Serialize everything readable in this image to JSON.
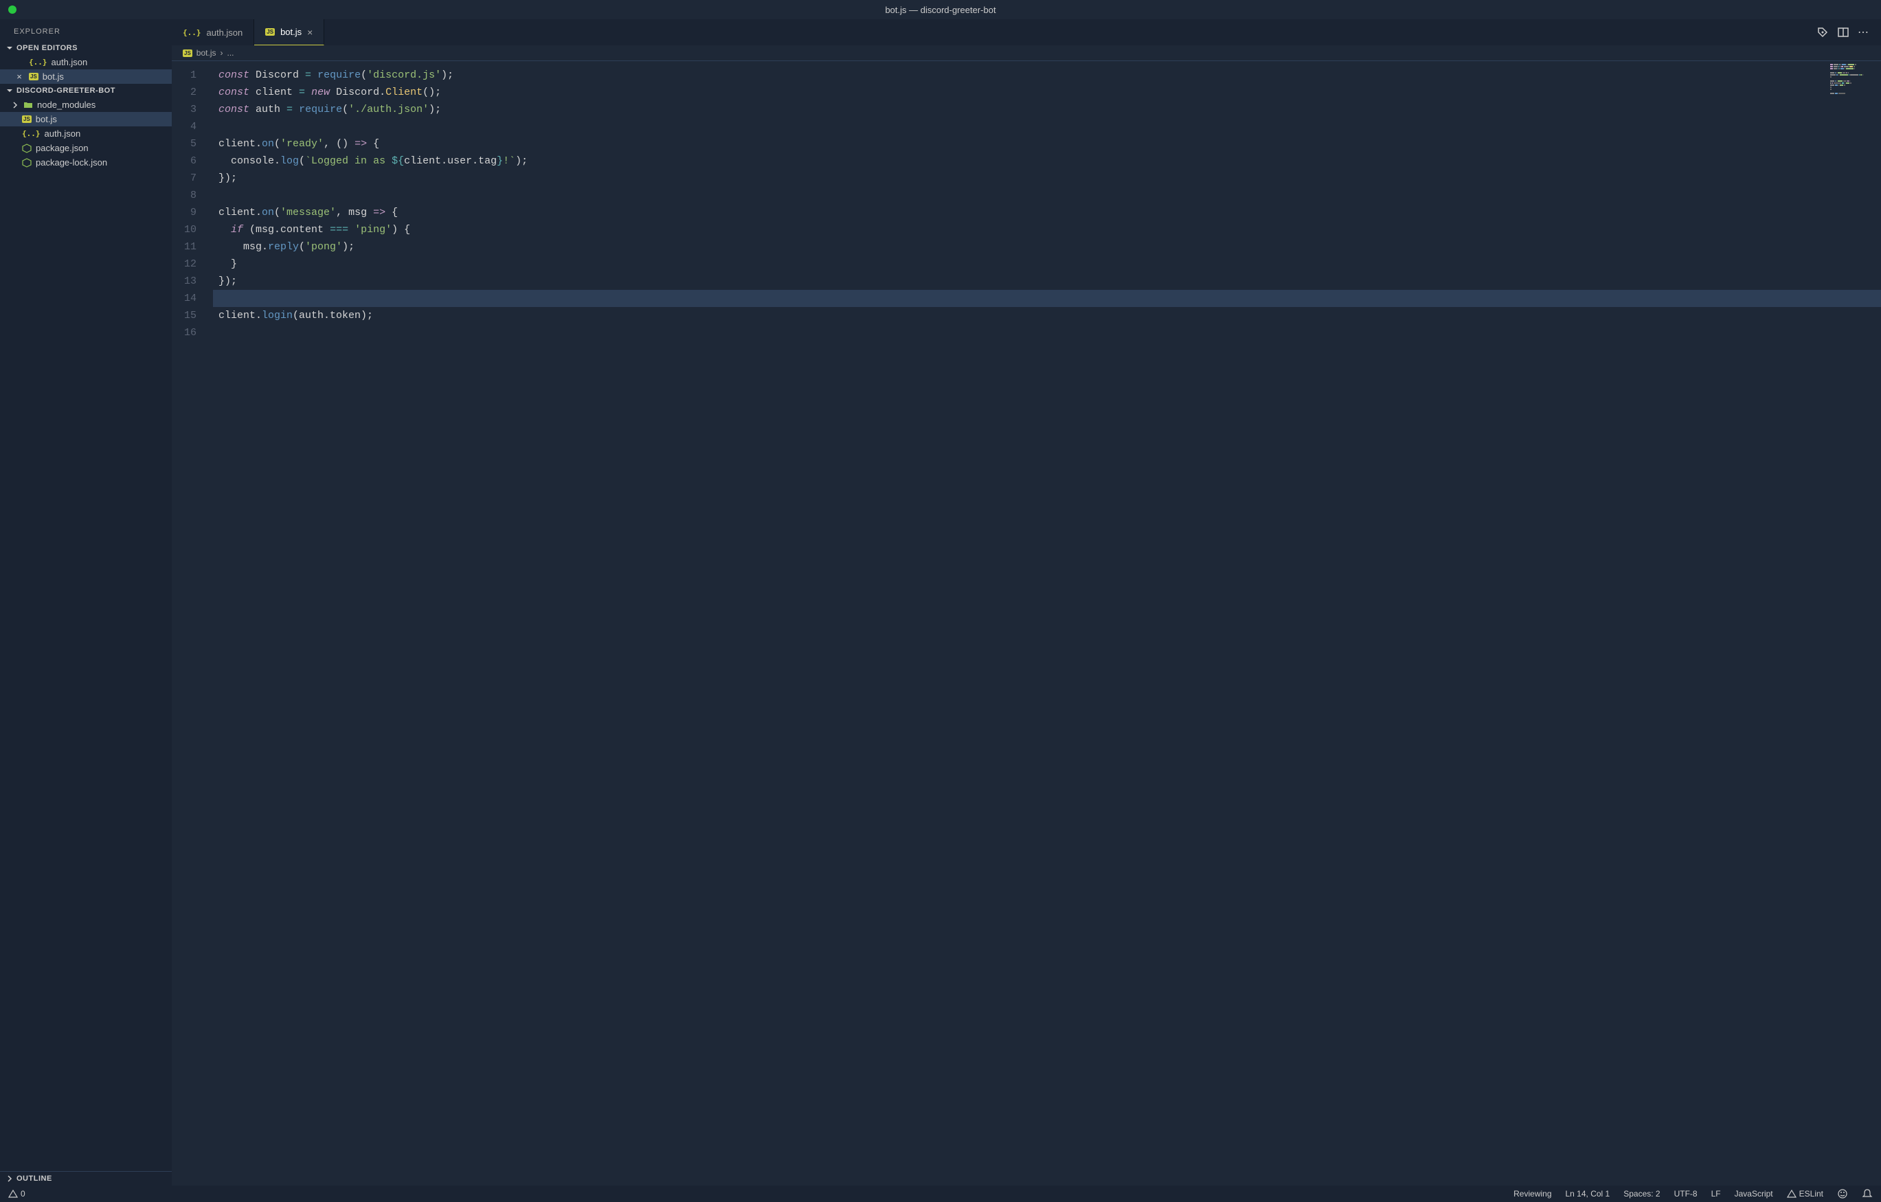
{
  "titlebar": {
    "title": "bot.js — discord-greeter-bot"
  },
  "sidebar": {
    "explorer_label": "EXPLORER",
    "open_editors_label": "OPEN EDITORS",
    "open_editors": [
      {
        "name": "auth.json",
        "icon": "json",
        "modified": false
      },
      {
        "name": "bot.js",
        "icon": "js",
        "modified": true,
        "active": true
      }
    ],
    "project_label": "DISCORD-GREETER-BOT",
    "files": [
      {
        "name": "node_modules",
        "icon": "folder",
        "chevron": true
      },
      {
        "name": "bot.js",
        "icon": "js",
        "active": true
      },
      {
        "name": "auth.json",
        "icon": "json"
      },
      {
        "name": "package.json",
        "icon": "npm"
      },
      {
        "name": "package-lock.json",
        "icon": "npm"
      }
    ],
    "outline_label": "OUTLINE"
  },
  "tabs": [
    {
      "name": "auth.json",
      "icon": "json",
      "active": false
    },
    {
      "name": "bot.js",
      "icon": "js",
      "active": true
    }
  ],
  "breadcrumb": {
    "file": "bot.js",
    "more": "..."
  },
  "code": {
    "line_count": 16,
    "highlighted_line": 14,
    "lines": [
      [
        [
          "keyword",
          "const"
        ],
        [
          "var",
          " Discord "
        ],
        [
          "op",
          "="
        ],
        [
          "var",
          " "
        ],
        [
          "func",
          "require"
        ],
        [
          "punct",
          "("
        ],
        [
          "string",
          "'discord.js'"
        ],
        [
          "punct",
          ");"
        ]
      ],
      [
        [
          "keyword",
          "const"
        ],
        [
          "var",
          " client "
        ],
        [
          "op",
          "="
        ],
        [
          "var",
          " "
        ],
        [
          "new",
          "new"
        ],
        [
          "var",
          " Discord."
        ],
        [
          "type",
          "Client"
        ],
        [
          "punct",
          "();"
        ]
      ],
      [
        [
          "keyword",
          "const"
        ],
        [
          "var",
          " auth "
        ],
        [
          "op",
          "="
        ],
        [
          "var",
          " "
        ],
        [
          "func",
          "require"
        ],
        [
          "punct",
          "("
        ],
        [
          "string",
          "'./auth.json'"
        ],
        [
          "punct",
          ");"
        ]
      ],
      [],
      [
        [
          "var",
          "client."
        ],
        [
          "func",
          "on"
        ],
        [
          "punct",
          "("
        ],
        [
          "string",
          "'ready'"
        ],
        [
          "punct",
          ", () "
        ],
        [
          "arrow",
          "=>"
        ],
        [
          "punct",
          " {"
        ]
      ],
      [
        [
          "var",
          "  console."
        ],
        [
          "func",
          "log"
        ],
        [
          "punct",
          "("
        ],
        [
          "temp",
          "`Logged in as "
        ],
        [
          "op",
          "${"
        ],
        [
          "tempexpr",
          "client.user.tag"
        ],
        [
          "op",
          "}"
        ],
        [
          "temp",
          "!`"
        ],
        [
          "punct",
          ");"
        ]
      ],
      [
        [
          "punct",
          "});"
        ]
      ],
      [],
      [
        [
          "var",
          "client."
        ],
        [
          "func",
          "on"
        ],
        [
          "punct",
          "("
        ],
        [
          "string",
          "'message'"
        ],
        [
          "punct",
          ", msg "
        ],
        [
          "arrow",
          "=>"
        ],
        [
          "punct",
          " {"
        ]
      ],
      [
        [
          "var",
          "  "
        ],
        [
          "keyword",
          "if"
        ],
        [
          "punct",
          " (msg.content "
        ],
        [
          "op",
          "==="
        ],
        [
          "punct",
          " "
        ],
        [
          "string",
          "'ping'"
        ],
        [
          "punct",
          ") {"
        ]
      ],
      [
        [
          "var",
          "    msg."
        ],
        [
          "func",
          "reply"
        ],
        [
          "punct",
          "("
        ],
        [
          "string",
          "'pong'"
        ],
        [
          "punct",
          ");"
        ]
      ],
      [
        [
          "punct",
          "  }"
        ]
      ],
      [
        [
          "punct",
          "});"
        ]
      ],
      [],
      [
        [
          "var",
          "client."
        ],
        [
          "func",
          "login"
        ],
        [
          "punct",
          "(auth.token);"
        ]
      ],
      []
    ]
  },
  "statusbar": {
    "warning_count": "0",
    "reviewing": "Reviewing",
    "cursor": "Ln 14, Col 1",
    "spaces": "Spaces: 2",
    "encoding": "UTF-8",
    "eol": "LF",
    "language": "JavaScript",
    "linter": "ESLint"
  }
}
